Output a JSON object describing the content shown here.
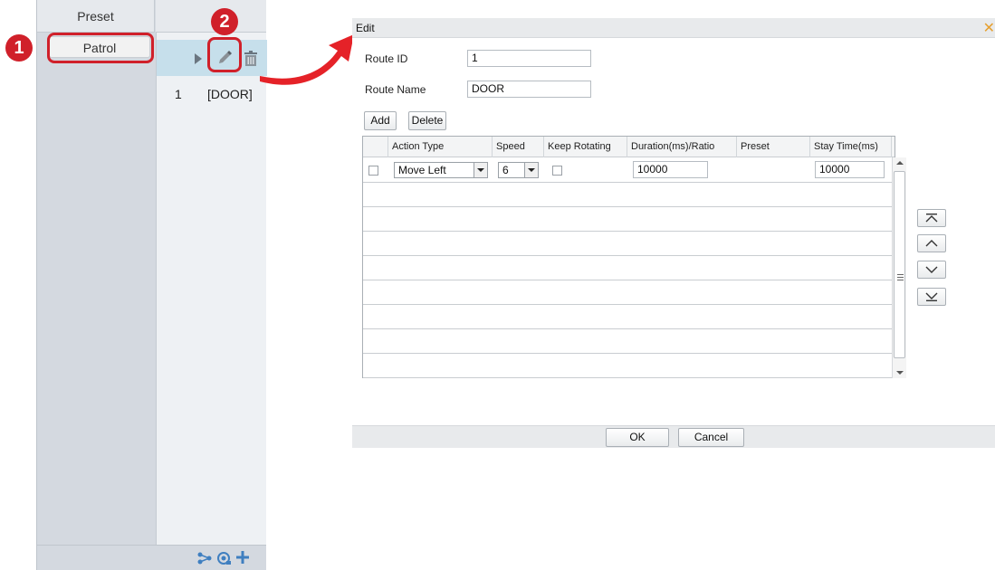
{
  "left_panel": {
    "tab_preset": "Preset",
    "tab_patrol": "Patrol",
    "routes": [
      {
        "number": "1",
        "name": "[DOOR]"
      }
    ]
  },
  "callouts": {
    "one": "1",
    "two": "2"
  },
  "dialog": {
    "title": "Edit",
    "route_id_label": "Route ID",
    "route_id_value": "1",
    "route_name_label": "Route Name",
    "route_name_value": "DOOR",
    "add_label": "Add",
    "delete_label": "Delete",
    "columns": [
      "Action Type",
      "Speed",
      "Keep Rotating",
      "Duration(ms)/Ratio",
      "Preset",
      "Stay Time(ms)"
    ],
    "rows": [
      {
        "action_type": "Move Left",
        "speed": "6",
        "keep_rotating": false,
        "duration": "10000",
        "preset": "",
        "stay_time": "10000"
      }
    ],
    "ok_label": "OK",
    "cancel_label": "Cancel"
  },
  "colors": {
    "callout_red": "#d0202a",
    "selected_row": "#c6dfeb",
    "close_icon": "#e6a030"
  }
}
